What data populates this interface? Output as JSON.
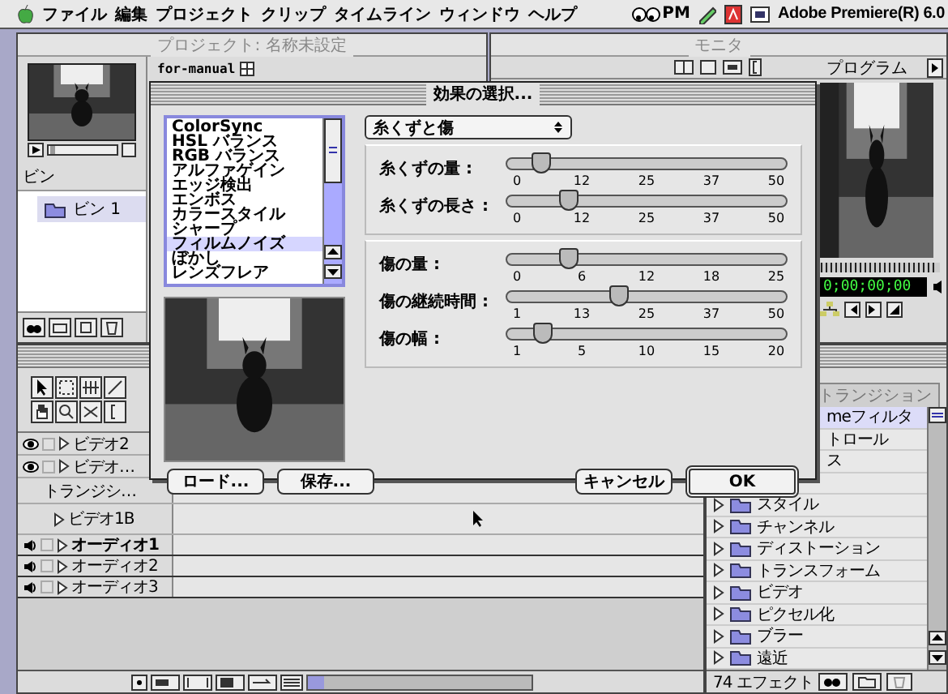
{
  "menu_bar": {
    "items": [
      "ファイル",
      "編集",
      "プロジェクト",
      "クリップ",
      "タイムライン",
      "ウィンドウ",
      "ヘルプ"
    ],
    "clock": "PM",
    "app_name": "Adobe Premiere(R) 6.0"
  },
  "project": {
    "title": "プロジェクト: 名称未設定",
    "clip_name": "for-manual",
    "bin_header": "ビン",
    "bins": [
      {
        "label": "ビン 1",
        "selected": true
      }
    ]
  },
  "monitor": {
    "title": "モニタ",
    "view": "プログラム",
    "timecode": "0;00;00;00"
  },
  "timeline": {
    "tracks": [
      {
        "kind": "video",
        "name": "ビデオ2",
        "target": false
      },
      {
        "kind": "video",
        "name": "ビデオ…",
        "target": false
      },
      {
        "kind": "transition",
        "name": "トランジシ…",
        "target": false
      },
      {
        "kind": "sub",
        "name": "ビデオ1B",
        "target": false
      },
      {
        "kind": "audio",
        "name": "オーディオ1",
        "target": true
      },
      {
        "kind": "audio",
        "name": "オーディオ2",
        "target": false
      },
      {
        "kind": "audio",
        "name": "オーディオ3",
        "target": false
      }
    ]
  },
  "dialog": {
    "title": "効果の選択...",
    "effects": [
      {
        "label": "ColorSync",
        "selected": false
      },
      {
        "label": "HSL バランス",
        "selected": false
      },
      {
        "label": "RGB バランス",
        "selected": false
      },
      {
        "label": "アルファゲイン",
        "selected": false
      },
      {
        "label": "エッジ検出",
        "selected": false
      },
      {
        "label": "エンボス",
        "selected": false
      },
      {
        "label": "カラースタイル",
        "selected": false
      },
      {
        "label": "シャープ",
        "selected": false
      },
      {
        "label": "フィルムノイズ",
        "selected": true
      },
      {
        "label": "ぼかし",
        "selected": false
      },
      {
        "label": "レンズフレア",
        "selected": false
      }
    ],
    "filter": "糸くずと傷",
    "groups": [
      {
        "sliders": [
          {
            "label": "糸くずの量 :",
            "level": 0.12,
            "ticks": [
              "0",
              "12",
              "25",
              "37",
              "50"
            ]
          },
          {
            "label": "糸くずの長さ :",
            "level": 0.22,
            "ticks": [
              "0",
              "12",
              "25",
              "37",
              "50"
            ]
          }
        ]
      },
      {
        "sliders": [
          {
            "label": "傷の量 :",
            "level": 0.22,
            "ticks": [
              "0",
              "6",
              "12",
              "18",
              "25"
            ]
          },
          {
            "label": "傷の継続時間 :",
            "level": 0.4,
            "ticks": [
              "1",
              "13",
              "25",
              "37",
              "50"
            ]
          },
          {
            "label": "傷の幅 :",
            "level": 0.13,
            "ticks": [
              "1",
              "5",
              "10",
              "15",
              "20"
            ]
          }
        ]
      }
    ],
    "left_buttons": [
      {
        "label": "ロード...",
        "default": false
      },
      {
        "label": "保存...",
        "default": false
      }
    ],
    "right_buttons": [
      {
        "label": "キャンセル",
        "default": false
      },
      {
        "label": "OK",
        "default": true
      }
    ]
  },
  "effects_palette": {
    "tabs": [
      {
        "label": "トランジション",
        "selected": false
      }
    ],
    "items": [
      {
        "kind": "partial",
        "label": "meフィルタ",
        "selected": true
      },
      {
        "kind": "partial",
        "label": "トロール",
        "selected": false
      },
      {
        "kind": "partial",
        "label": "ス",
        "selected": false
      },
      {
        "kind": "partial",
        "selected": false
      },
      {
        "kind": "folder",
        "label": "スタイル",
        "selected": false
      },
      {
        "kind": "folder",
        "label": "チャンネル",
        "selected": false
      },
      {
        "kind": "folder",
        "label": "ディストーション",
        "selected": false
      },
      {
        "kind": "folder",
        "label": "トランスフォーム",
        "selected": false
      },
      {
        "kind": "folder",
        "label": "ビデオ",
        "selected": false
      },
      {
        "kind": "folder",
        "label": "ピクセル化",
        "selected": false
      },
      {
        "kind": "folder",
        "label": "ブラー",
        "selected": false
      },
      {
        "kind": "folder",
        "label": "遠近",
        "selected": false
      }
    ],
    "count": "74 エフェクト"
  }
}
